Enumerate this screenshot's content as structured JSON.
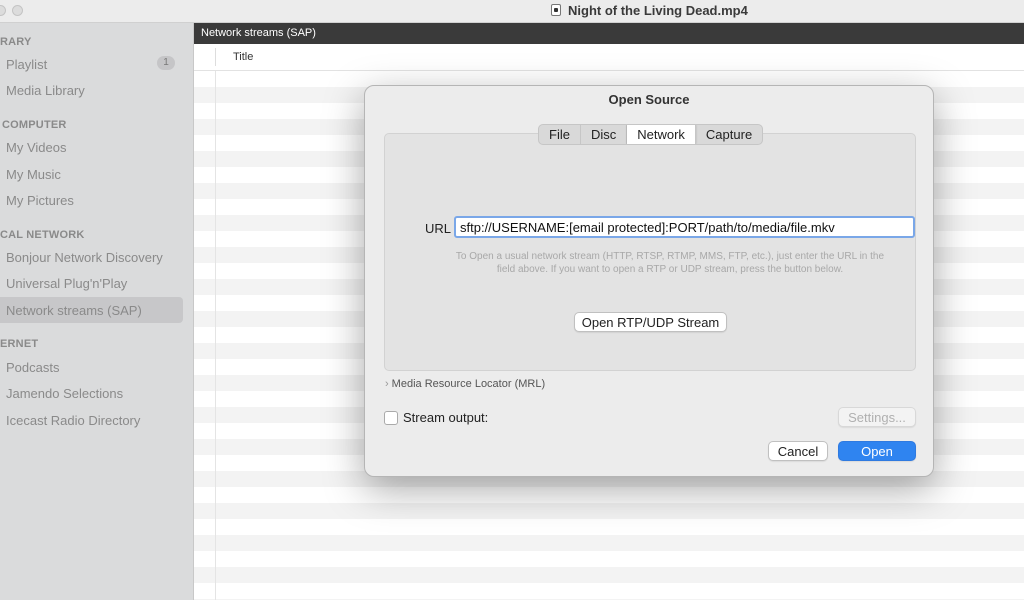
{
  "window": {
    "title": "Night of the Living Dead.mp4"
  },
  "sidebar": {
    "sections": [
      {
        "header": "RARY",
        "items": [
          {
            "label": "Playlist",
            "badge": "1"
          },
          {
            "label": "Media Library"
          }
        ]
      },
      {
        "header": "COMPUTER",
        "items": [
          {
            "label": "My Videos"
          },
          {
            "label": "My Music"
          },
          {
            "label": "My Pictures"
          }
        ]
      },
      {
        "header": "CAL NETWORK",
        "items": [
          {
            "label": "Bonjour Network Discovery"
          },
          {
            "label": "Universal Plug'n'Play"
          },
          {
            "label": "Network streams (SAP)"
          }
        ]
      },
      {
        "header": "ERNET",
        "items": [
          {
            "label": "Podcasts"
          },
          {
            "label": "Jamendo Selections"
          },
          {
            "label": "Icecast Radio Directory"
          }
        ]
      }
    ],
    "selected": "Network streams (SAP)"
  },
  "main": {
    "header_title": "Network streams (SAP)",
    "column_title": "Title"
  },
  "dialog": {
    "title": "Open Source",
    "tabs": [
      "File",
      "Disc",
      "Network",
      "Capture"
    ],
    "active_tab": "Network",
    "url_label": "URL",
    "url_value": "sftp://USERNAME:[email protected]:PORT/path/to/media/file.mkv",
    "hint_line1": "To Open a usual network stream (HTTP, RTSP, RTMP, MMS, FTP, etc.), just enter the URL in the",
    "hint_line2": "field above. If you want to open a RTP or UDP stream, press the button below.",
    "rtp_button": "Open RTP/UDP Stream",
    "mrl_label": "Media Resource Locator (MRL)",
    "stream_output_label": "Stream output:",
    "stream_output_checked": false,
    "settings_button": "Settings...",
    "cancel_button": "Cancel",
    "open_button": "Open"
  },
  "colors": {
    "accent": "#2f84f0",
    "main_header_bg": "#3a3a3a",
    "sidebar_bg": "#dadbdc"
  }
}
